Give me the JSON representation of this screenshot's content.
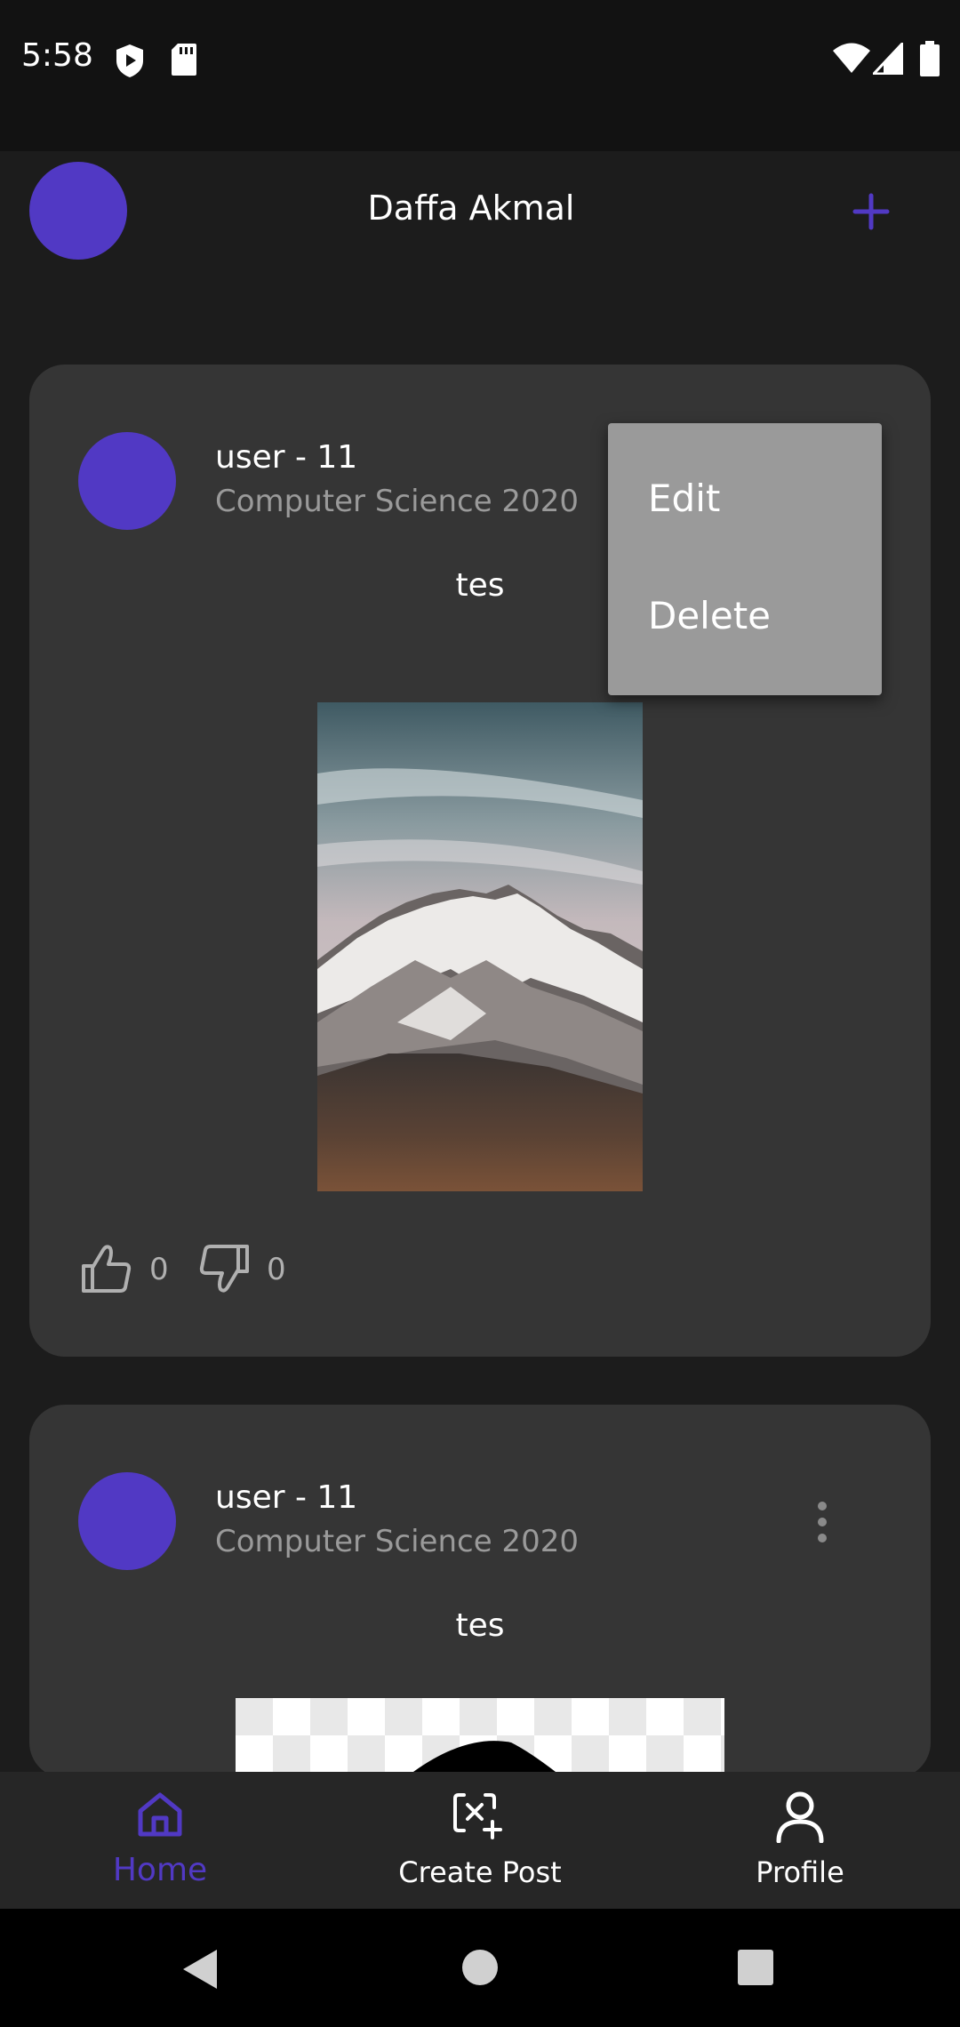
{
  "status_bar": {
    "time": "5:58",
    "icons": [
      "shield-play-icon",
      "sd-card-icon",
      "wifi-icon",
      "signal-icon",
      "battery-icon"
    ]
  },
  "header": {
    "title": "Daffa Akmal",
    "add_icon": "plus-icon"
  },
  "posts": [
    {
      "user": "user - 11",
      "subtitle": "Computer Science 2020",
      "text": "tes",
      "image": "mountain-photo",
      "likes": "0",
      "dislikes": "0"
    },
    {
      "user": "user - 11",
      "subtitle": "Computer Science 2020",
      "text": "tes",
      "image": "transparent-checker-image"
    }
  ],
  "context_menu": {
    "items": [
      "Edit",
      "Delete"
    ]
  },
  "bottom_nav": {
    "items": [
      {
        "label": "Home",
        "icon": "home-icon",
        "active": true
      },
      {
        "label": "Create Post",
        "icon": "create-post-icon",
        "active": false
      },
      {
        "label": "Profile",
        "icon": "profile-icon",
        "active": false
      }
    ]
  },
  "colors": {
    "accent": "#5139c4",
    "card": "#353535",
    "background": "#1c1c1c",
    "menu": "#9a9a9a"
  }
}
